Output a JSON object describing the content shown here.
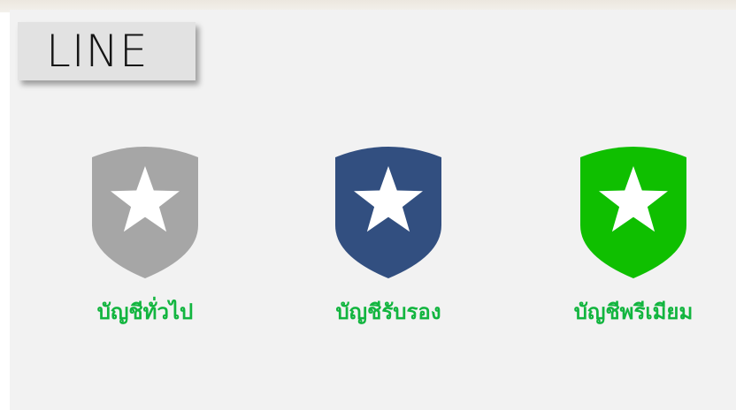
{
  "header": {
    "title": "LINE"
  },
  "accounts": [
    {
      "label": "บัญชีทั่วไป",
      "icon": "shield-star-icon",
      "color": "#a6a6a6"
    },
    {
      "label": "บัญชีรับรอง",
      "icon": "shield-star-icon",
      "color": "#324f80"
    },
    {
      "label": "บัญชีพรีเมียม",
      "icon": "shield-star-icon",
      "color": "#0fbf00"
    }
  ],
  "colors": {
    "label_text": "#12b53f",
    "panel_bg": "#f2f2f2"
  }
}
